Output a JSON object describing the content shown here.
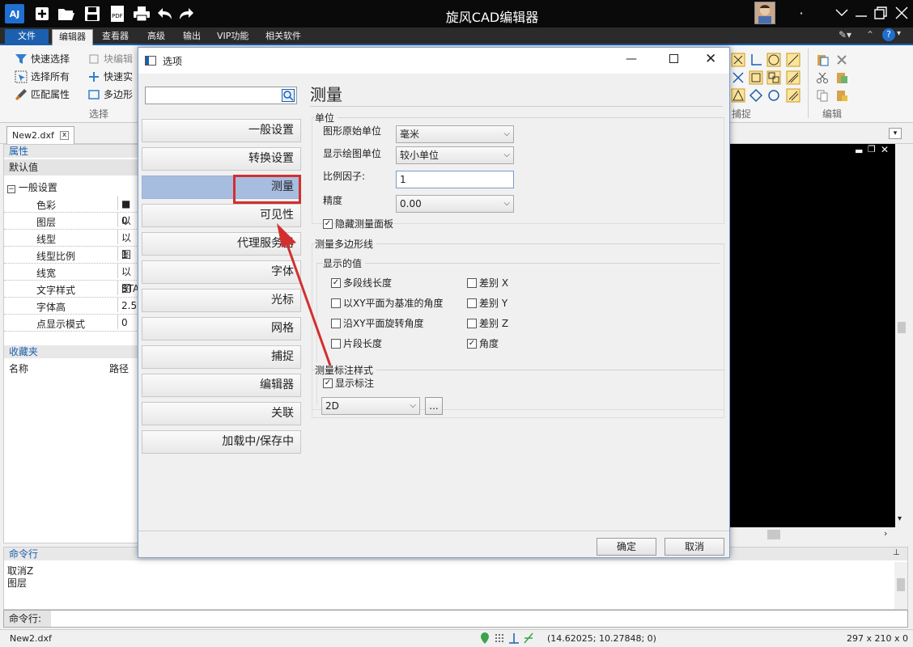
{
  "app": {
    "title": "旋风CAD编辑器",
    "logo": "AJ"
  },
  "menu": {
    "file": "文件",
    "tabs": [
      "编辑器",
      "查看器",
      "高级",
      "输出",
      "VIP功能",
      "相关软件"
    ]
  },
  "ribbon": {
    "select_items": [
      "快速选择",
      "选择所有",
      "匹配属性"
    ],
    "block_items": [
      "块编辑",
      "快速实",
      "多边形"
    ],
    "group_select": "选择",
    "group_snap": "捕捉",
    "group_edit": "编辑"
  },
  "document": {
    "tab": "New2.dxf"
  },
  "properties": {
    "header": "属性",
    "default": "默认值",
    "general": "一般设置",
    "rows": [
      {
        "name": "色彩",
        "value": "■以"
      },
      {
        "name": "图层",
        "value": "0"
      },
      {
        "name": "线型",
        "value": "以图"
      },
      {
        "name": "线型比例",
        "value": "1"
      },
      {
        "name": "线宽",
        "value": "以图"
      },
      {
        "name": "文字样式",
        "value": "STAN"
      },
      {
        "name": "字体高",
        "value": "2.5"
      },
      {
        "name": "点显示模式",
        "value": "0"
      }
    ]
  },
  "favorites": {
    "header": "收藏夹",
    "col_name": "名称",
    "col_path": "路径"
  },
  "command": {
    "header": "命令行",
    "lines": [
      "取消Z",
      "图层"
    ],
    "prompt": "命令行:"
  },
  "status": {
    "file": "New2.dxf",
    "coords": "(14.62025; 10.27848; 0)",
    "paper": "297 x 210 x 0"
  },
  "dialog": {
    "title": "选项",
    "search_placeholder": "",
    "nav": [
      "一般设置",
      "转换设置",
      "测量",
      "可见性",
      "代理服务器",
      "字体",
      "光标",
      "网格",
      "捕捉",
      "编辑器",
      "关联",
      "加载中/保存中"
    ],
    "selected_index": 2,
    "heading": "测量",
    "units": {
      "legend": "单位",
      "drawing_unit_label": "图形原始单位",
      "drawing_unit_value": "毫米",
      "display_unit_label": "显示绘图单位",
      "display_unit_value": "较小单位",
      "scale_label": "比例因子:",
      "scale_value": "1",
      "precision_label": "精度",
      "precision_value": "0.00",
      "hide_panel": "隐藏测量面板"
    },
    "polyline": {
      "legend": "测量多边形线",
      "sub_legend": "显示的值",
      "opts": [
        {
          "label": "多段线长度",
          "checked": true
        },
        {
          "label": "以XY平面为基准的角度",
          "checked": false
        },
        {
          "label": "沿XY平面旋转角度",
          "checked": false
        },
        {
          "label": "片段长度",
          "checked": false
        },
        {
          "label": "差别 X",
          "checked": false
        },
        {
          "label": "差别 Y",
          "checked": false
        },
        {
          "label": "差别 Z",
          "checked": false
        },
        {
          "label": "角度",
          "checked": true
        }
      ]
    },
    "dim_style": {
      "legend": "测量标注样式",
      "show": "显示标注",
      "value": "2D",
      "browse": "..."
    },
    "ok": "确定",
    "cancel": "取消"
  },
  "colors": {
    "accent": "#1b5fae",
    "highlight": "#d32f2f",
    "nav_selected": "#a7bde0"
  }
}
